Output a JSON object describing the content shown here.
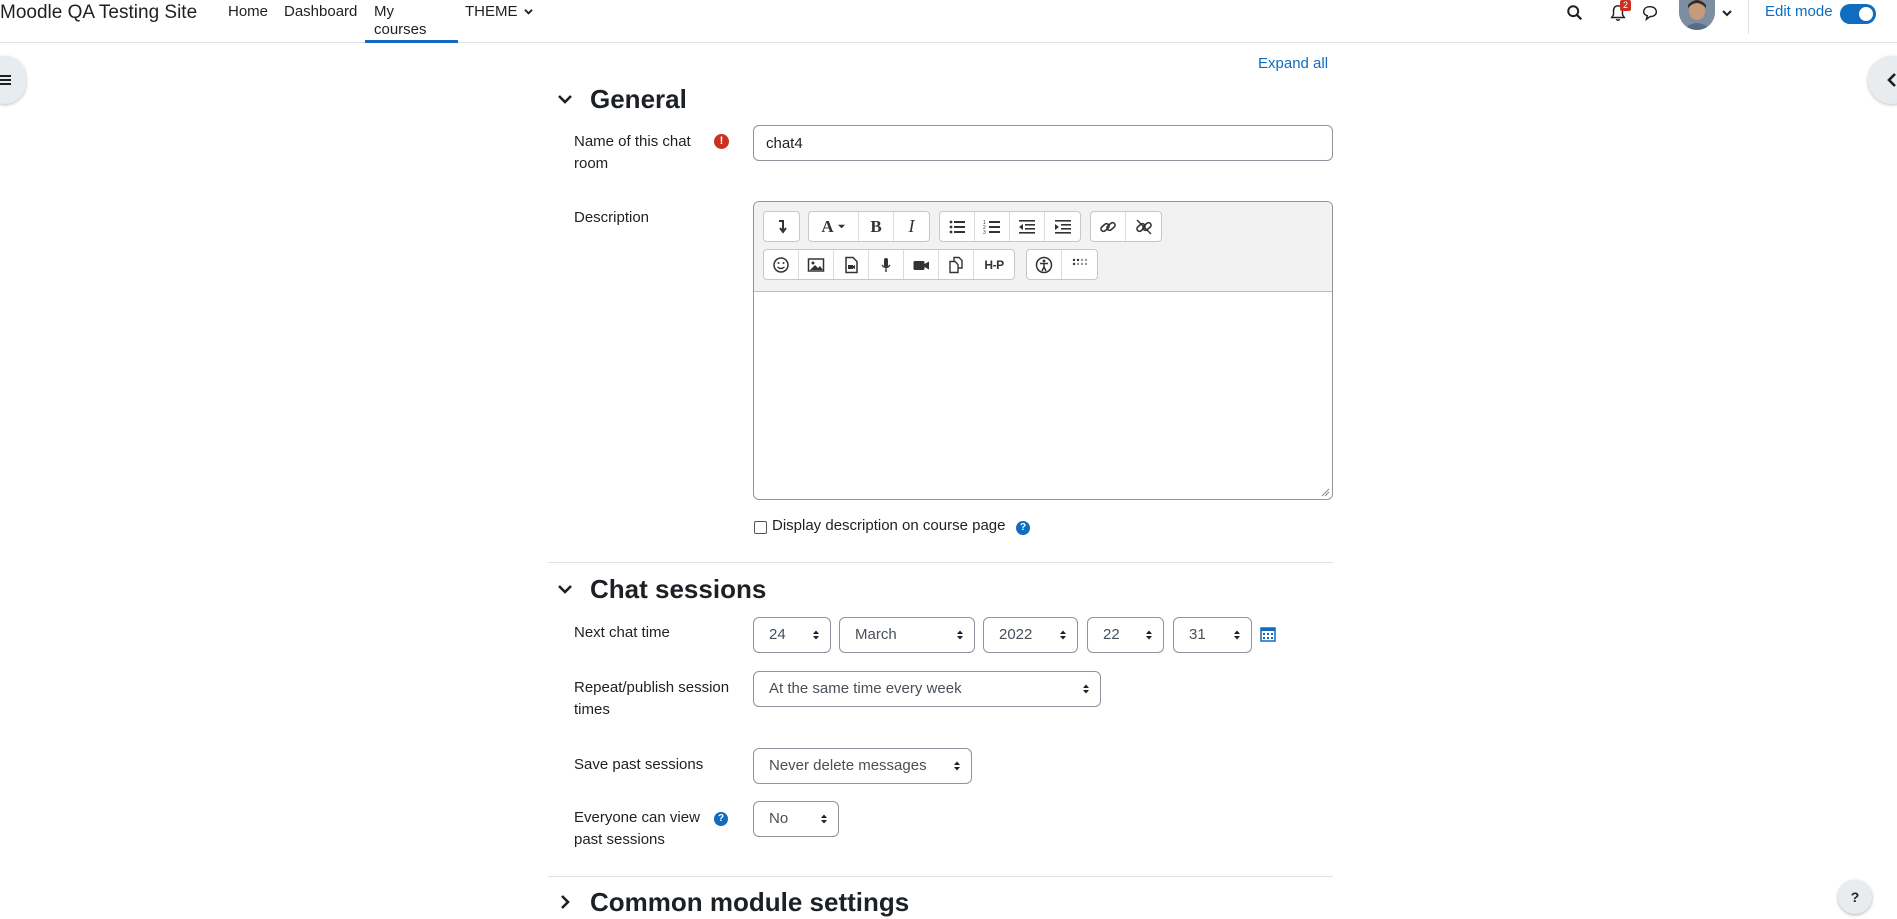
{
  "navbar": {
    "brand": "Moodle QA Testing Site",
    "items": [
      "Home",
      "Dashboard",
      "My courses",
      "THEME"
    ],
    "active_item": "My courses",
    "notification_count": "2",
    "edit_mode_label": "Edit mode",
    "edit_mode_on": true,
    "icons": [
      "search-icon",
      "bell-icon",
      "chat-bubble-icon",
      "avatar",
      "chevron-down-icon"
    ]
  },
  "form": {
    "expand_all": "Expand all",
    "sections": {
      "general": "General",
      "chat_sessions": "Chat sessions",
      "common_module": "Common module settings"
    },
    "name_label": "Name of this chat room",
    "name_value": "chat4",
    "description_label": "Description",
    "display_description_label": "Display description on course page",
    "display_description_checked": false,
    "next_chat_time_label": "Next chat time",
    "next_chat_time": {
      "day": "24",
      "month": "March",
      "year": "2022",
      "hour": "22",
      "minute": "31"
    },
    "repeat_label": "Repeat/publish session times",
    "repeat_value": "At the same time every week",
    "save_past_label": "Save past sessions",
    "save_past_value": "Never delete messages",
    "everyone_view_label": "Everyone can view past sessions",
    "everyone_view_value": "No"
  },
  "editor": {
    "toolbar_row1": [
      "collapse-icon",
      "font-style-icon",
      "bold-icon",
      "italic-icon",
      "unordered-list-icon",
      "ordered-list-icon",
      "outdent-icon",
      "indent-icon",
      "link-icon",
      "unlink-icon"
    ],
    "toolbar_row2": [
      "emoji-icon",
      "image-icon",
      "media-icon",
      "record-audio-icon",
      "record-video-icon",
      "manage-files-icon",
      "h5p-icon",
      "accessibility-checker-icon",
      "screenreader-helper-icon"
    ],
    "h5p_label": "H-P"
  },
  "help_button": "?",
  "colors": {
    "primary": "#0f6cbf",
    "required": "#ca3120",
    "text": "#1d2125"
  }
}
